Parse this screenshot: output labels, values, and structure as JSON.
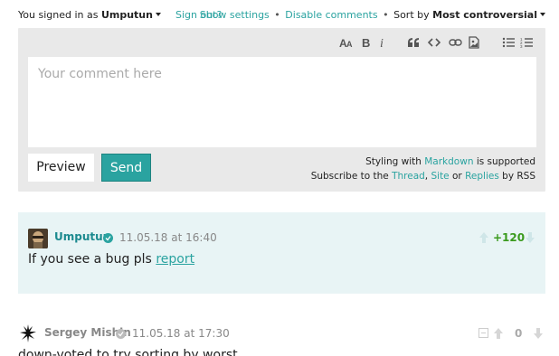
{
  "topbar": {
    "signed_in_prefix": "You signed in as",
    "username": "Umputun",
    "sign_out": "Sign out?",
    "show_settings": "Show settings",
    "bullet": "•",
    "disable_comments": "Disable comments",
    "sort_prefix": "Sort by",
    "sort_value": "Most controversial"
  },
  "editor": {
    "toolbar_icons": [
      "text-size-icon",
      "bold-icon",
      "italic-icon",
      "quote-icon",
      "code-icon",
      "link-icon",
      "image-icon",
      "bullet-list-icon",
      "numbered-list-icon"
    ],
    "placeholder": "Your comment here",
    "preview_label": "Preview",
    "send_label": "Send",
    "hint_line1_prefix": "Styling with",
    "hint_line1_link": "Markdown",
    "hint_line1_suffix": "is supported",
    "hint_line2_prefix": "Subscribe to the",
    "hint_thread": "Thread",
    "hint_comma": ",",
    "hint_site": "Site",
    "hint_or": "or",
    "hint_replies": "Replies",
    "hint_line2_suffix": "by RSS",
    "accent_color": "#2aa3a0"
  },
  "comments": [
    {
      "author": "Umputun",
      "date": "11.05.18 at 16:40",
      "text": "If you see a bug pls",
      "link_text": "report",
      "score": "+120",
      "score_color": "#3a9a1d",
      "background": "#e8f4f5"
    },
    {
      "author": "Sergey Mishin",
      "date": "11.05.18 at 17:30",
      "text": "down-voted to try sorting by worst",
      "score": "0"
    }
  ]
}
